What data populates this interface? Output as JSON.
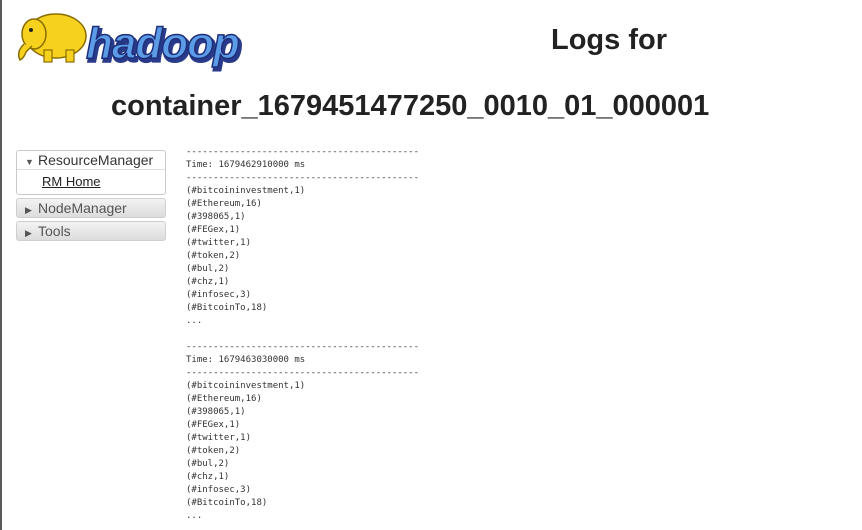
{
  "header": {
    "logo_text": "hadoop",
    "title_line1": "Logs for",
    "title_line2": "container_1679451477250_0010_01_000001"
  },
  "colors": {
    "logo_blue": "#2e3d8c",
    "logo_elephant": "#f6d21e",
    "nav_border": "#c9c9c9"
  },
  "sidebar": {
    "sections": [
      {
        "label": "ResourceManager",
        "expanded": true,
        "icon": "triangle-down-icon",
        "links": [
          {
            "label": "RM Home"
          }
        ]
      },
      {
        "label": "NodeManager",
        "expanded": false,
        "icon": "triangle-right-icon"
      },
      {
        "label": "Tools",
        "expanded": false,
        "icon": "triangle-right-icon"
      }
    ]
  },
  "log": {
    "separator": "-------------------------------------------",
    "blocks": [
      {
        "time": "Time: 1679462910000 ms",
        "entries": [
          "(#bitcoininvestment,1)",
          "(#Ethereum,16)",
          "(#398065,1)",
          "(#FEGex,1)",
          "(#twitter,1)",
          "(#token,2)",
          "(#bul,2)",
          "(#chz,1)",
          "(#infosec,3)",
          "(#BitcoinTo,18)",
          "..."
        ]
      },
      {
        "time": "Time: 1679463030000 ms",
        "entries": [
          "(#bitcoininvestment,1)",
          "(#Ethereum,16)",
          "(#398065,1)",
          "(#FEGex,1)",
          "(#twitter,1)",
          "(#token,2)",
          "(#bul,2)",
          "(#chz,1)",
          "(#infosec,3)",
          "(#BitcoinTo,18)",
          "..."
        ]
      }
    ]
  }
}
